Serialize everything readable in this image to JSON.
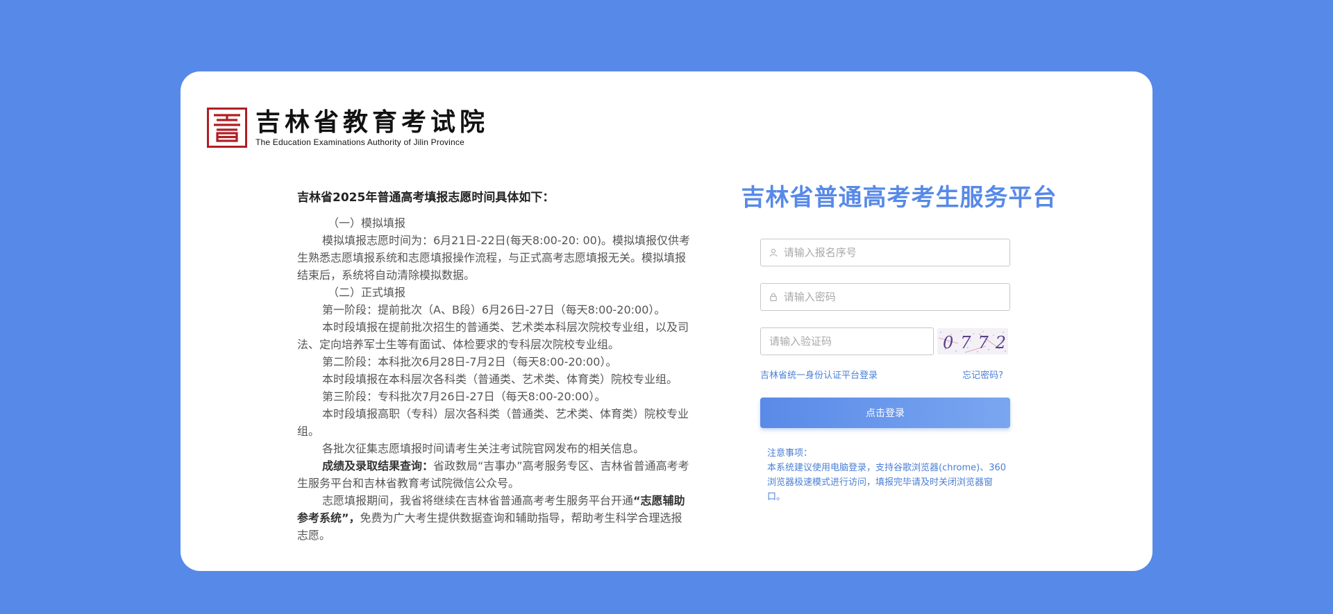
{
  "logo": {
    "cn": "吉林省教育考试院",
    "en": "The Education Examinations Authority of Jilin Province"
  },
  "notice": {
    "title": "吉林省2025年普通高考填报志愿时间具体如下：",
    "sec1_title": "（一）模拟填报",
    "sec1_body": "模拟填报志愿时间为：6月21日-22日(每天8:00-20: 00)。模拟填报仅供考生熟悉志愿填报系统和志愿填报操作流程，与正式高考志愿填报无关。模拟填报结束后，系统将自动清除模拟数据。",
    "sec2_title": "（二）正式填报",
    "stage1_title": "第一阶段：提前批次（A、B段）6月26日-27日（每天8:00-20:00）。",
    "stage1_body": "本时段填报在提前批次招生的普通类、艺术类本科层次院校专业组，以及司法、定向培养军士生等有面试、体检要求的专科层次院校专业组。",
    "stage2_title": "第二阶段：本科批次6月28日-7月2日（每天8:00-20:00）。",
    "stage2_body": "本时段填报在本科层次各科类（普通类、艺术类、体育类）院校专业组。",
    "stage3_title": "第三阶段：专科批次7月26日-27日（每天8:00-20:00）。",
    "stage3_body": "本时段填报高职（专科）层次各科类（普通类、艺术类、体育类）院校专业组。",
    "collect": "各批次征集志愿填报时间请考生关注考试院官网发布的相关信息。",
    "result_label": "成绩及录取结果查询：",
    "result_body": "省政数局“吉事办”高考服务专区、吉林省普通高考考生服务平台和吉林省教育考试院微信公众号。",
    "aux_pre": "志愿填报期间，我省将继续在吉林省普通高考考生服务平台开通",
    "aux_bold": "“志愿辅助参考系统”，",
    "aux_post": "免费为广大考生提供数据查询和辅助指导，帮助考生科学合理选报志愿。"
  },
  "login": {
    "title": "吉林省普通高考考生服务平台",
    "username_placeholder": "请输入报名序号",
    "password_placeholder": "请输入密码",
    "captcha_placeholder": "请输入验证码",
    "captcha_text": "0772",
    "unified_login_link": "吉林省统一身份认证平台登录",
    "forgot_link": "忘记密码?",
    "login_button": "点击登录",
    "tips_title": "注意事项：",
    "tips_body": "本系统建议使用电脑登录，支持谷歌浏览器(chrome)、360浏览器极速模式进行访问，填报完毕请及时关闭浏览器窗口。"
  },
  "colors": {
    "background": "#5789e8",
    "accent": "#5789e8",
    "seal": "#b01e24",
    "link": "#4a7fd6"
  }
}
